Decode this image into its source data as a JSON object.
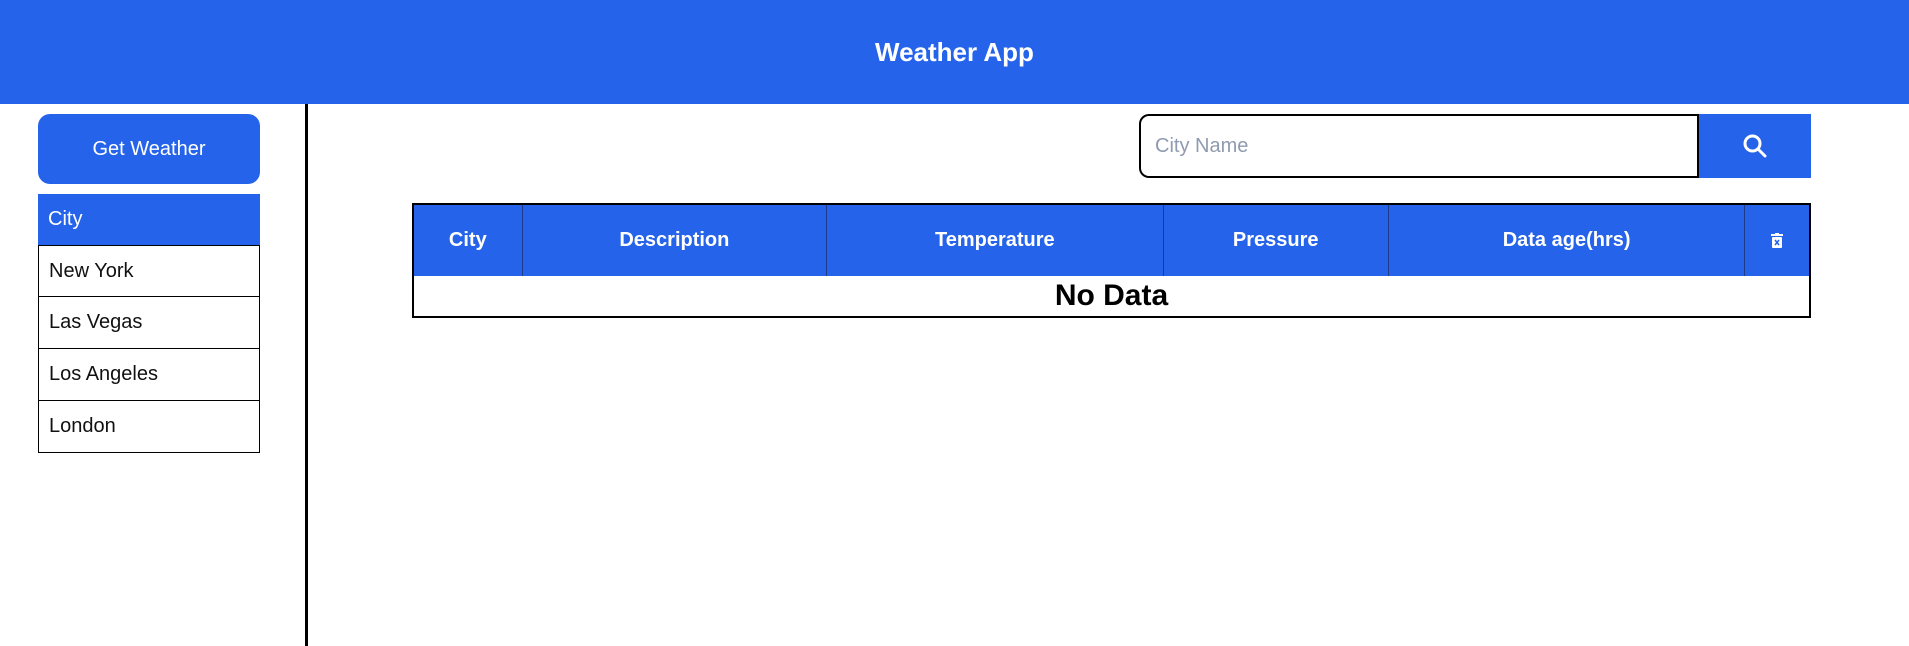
{
  "header": {
    "title": "Weather App"
  },
  "sidebar": {
    "get_weather_label": "Get Weather",
    "list_header": "City",
    "cities": [
      "New York",
      "Las Vegas",
      "Los Angeles",
      "London"
    ]
  },
  "search": {
    "placeholder": "City Name",
    "value": "",
    "button_icon": "search-icon"
  },
  "table": {
    "columns": [
      "City",
      "Description",
      "Temperature",
      "Pressure",
      "Data age(hrs)"
    ],
    "clear_icon": "trash-icon",
    "empty_message": "No Data"
  },
  "colors": {
    "accent": "#2563eb",
    "border": "#000000",
    "text_light": "#ffffff"
  }
}
